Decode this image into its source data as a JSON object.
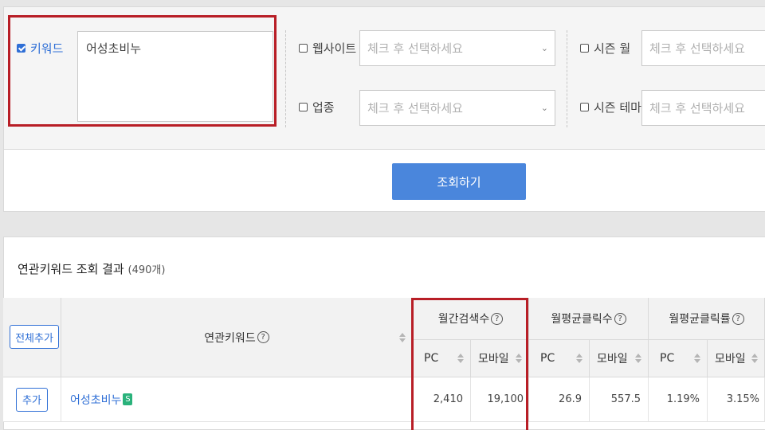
{
  "filters": {
    "keyword": {
      "label": "키워드",
      "checked": true,
      "value": "어성초비누"
    },
    "website": {
      "label": "웹사이트",
      "checked": false,
      "placeholder": "체크 후 선택하세요"
    },
    "industry": {
      "label": "업종",
      "checked": false,
      "placeholder": "체크 후 선택하세요"
    },
    "season_month": {
      "label": "시즌 월",
      "checked": false,
      "placeholder": "체크 후 선택하세요"
    },
    "season_theme": {
      "label": "시즌 테마",
      "checked": false,
      "placeholder": "체크 후 선택하세요"
    }
  },
  "search_button": {
    "label": "조회하기"
  },
  "results": {
    "title": "연관키워드 조회 결과",
    "count": "(490개)",
    "add_all_label": "전체추가",
    "columns": {
      "keyword": "연관키워드",
      "monthly_search": "월간검색수",
      "monthly_clicks": "월평균클릭수",
      "monthly_ctr": "월평균클릭률",
      "pc": "PC",
      "mobile": "모바일",
      "help": "?"
    },
    "rows": [
      {
        "add_label": "추가",
        "keyword": "어성초비누",
        "badge": "S",
        "search_pc": "2,410",
        "search_mobile": "19,100",
        "clicks_pc": "26.9",
        "clicks_mobile": "557.5",
        "ctr_pc": "1.19%",
        "ctr_mobile": "3.15%"
      }
    ]
  },
  "colors": {
    "accent": "#2f6fd6",
    "button": "#4a86dc",
    "highlight_border": "#b81e26",
    "badge": "#2ab27b"
  }
}
